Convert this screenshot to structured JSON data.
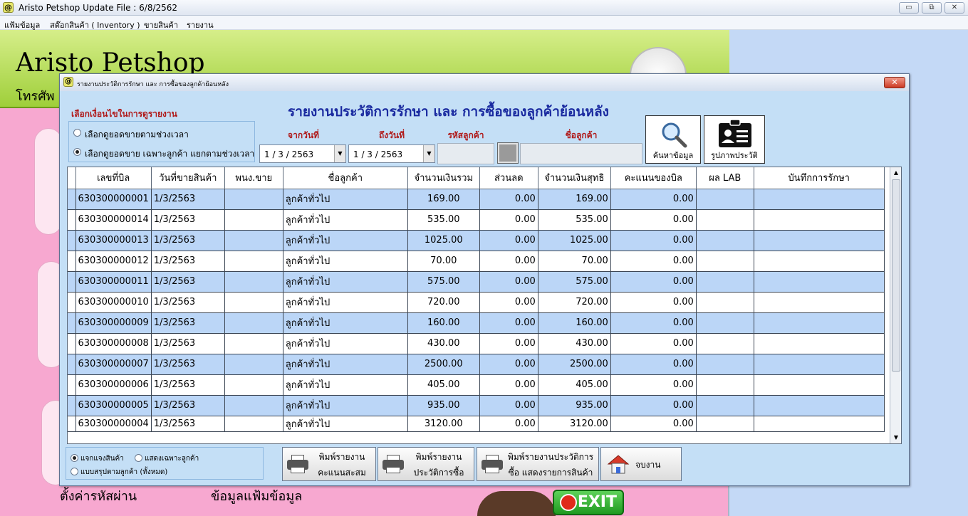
{
  "window": {
    "title": "Aristo Petshop  Update File : 6/8/2562",
    "logo_glyph": "@",
    "minimize_glyph": "▭",
    "restore_glyph": "⧉",
    "close_glyph": "✕"
  },
  "menu": [
    "แฟ้มข้อมูล",
    "สต๊อกสินค้า ( Inventory )",
    "ขายสินค้า",
    "รายงาน"
  ],
  "background": {
    "brand": "Aristo Petshop",
    "phone_prefix": "โทรศัพ",
    "left_text": "ตั้งค่ารหัสผ่าน",
    "middle_text": "ข้อมูลแฟ้มข้อมูล",
    "exit_label": "EXIT"
  },
  "dialog": {
    "title": "รายงานประวัติการรักษา และ การซื้อของลูกค้าย้อนหลัง",
    "heading": "รายงานประวัติการรักษา และ การซื้อของลูกค้าย้อนหลัง",
    "close_glyph": "✕",
    "conditions": {
      "label": "เลือกเงื่อนไขในการดูรายงาน",
      "options": [
        "เลือกดูยอดขายตามช่วงเวลา",
        "เลือกดูยอดขาย เฉพาะลูกค้า แยกตามช่วงเวลา"
      ],
      "selected_index": 1
    },
    "filters": {
      "from_label": "จากวันที่",
      "from_value": "1 / 3 / 2563",
      "to_label": "ถึงวันที่",
      "to_value": "1 / 3 / 2563",
      "customer_id_label": "รหัสลูกค้า",
      "customer_id_value": "",
      "customer_name_label": "ชื่อลูกค้า",
      "customer_name_value": "",
      "dropdown_arrow": "▼"
    },
    "search_button": "ค้นหาข้อมูล",
    "history_button": "รูปภาพประวัติ"
  },
  "grid": {
    "columns": [
      "เลขที่บิล",
      "วันที่ขายสินค้า",
      "พนง.ขาย",
      "ชื่อลูกค้า",
      "จำนวนเงินรวม",
      "ส่วนลด",
      "จำนวนเงินสุทธิ",
      "คะแนนของบิล",
      "ผล LAB",
      "บันทึกการรักษา"
    ],
    "rows": [
      {
        "bill": "630300000001",
        "date": "1/3/2563",
        "staff": "",
        "customer": "ลูกค้าทั่วไป",
        "total": "169.00",
        "discount": "0.00",
        "net": "169.00",
        "points": "0.00",
        "lab": "",
        "note": ""
      },
      {
        "bill": "630300000014",
        "date": "1/3/2563",
        "staff": "",
        "customer": "ลูกค้าทั่วไป",
        "total": "535.00",
        "discount": "0.00",
        "net": "535.00",
        "points": "0.00",
        "lab": "",
        "note": ""
      },
      {
        "bill": "630300000013",
        "date": "1/3/2563",
        "staff": "",
        "customer": "ลูกค้าทั่วไป",
        "total": "1025.00",
        "discount": "0.00",
        "net": "1025.00",
        "points": "0.00",
        "lab": "",
        "note": ""
      },
      {
        "bill": "630300000012",
        "date": "1/3/2563",
        "staff": "",
        "customer": "ลูกค้าทั่วไป",
        "total": "70.00",
        "discount": "0.00",
        "net": "70.00",
        "points": "0.00",
        "lab": "",
        "note": ""
      },
      {
        "bill": "630300000011",
        "date": "1/3/2563",
        "staff": "",
        "customer": "ลูกค้าทั่วไป",
        "total": "575.00",
        "discount": "0.00",
        "net": "575.00",
        "points": "0.00",
        "lab": "",
        "note": ""
      },
      {
        "bill": "630300000010",
        "date": "1/3/2563",
        "staff": "",
        "customer": "ลูกค้าทั่วไป",
        "total": "720.00",
        "discount": "0.00",
        "net": "720.00",
        "points": "0.00",
        "lab": "",
        "note": ""
      },
      {
        "bill": "630300000009",
        "date": "1/3/2563",
        "staff": "",
        "customer": "ลูกค้าทั่วไป",
        "total": "160.00",
        "discount": "0.00",
        "net": "160.00",
        "points": "0.00",
        "lab": "",
        "note": ""
      },
      {
        "bill": "630300000008",
        "date": "1/3/2563",
        "staff": "",
        "customer": "ลูกค้าทั่วไป",
        "total": "430.00",
        "discount": "0.00",
        "net": "430.00",
        "points": "0.00",
        "lab": "",
        "note": ""
      },
      {
        "bill": "630300000007",
        "date": "1/3/2563",
        "staff": "",
        "customer": "ลูกค้าทั่วไป",
        "total": "2500.00",
        "discount": "0.00",
        "net": "2500.00",
        "points": "0.00",
        "lab": "",
        "note": ""
      },
      {
        "bill": "630300000006",
        "date": "1/3/2563",
        "staff": "",
        "customer": "ลูกค้าทั่วไป",
        "total": "405.00",
        "discount": "0.00",
        "net": "405.00",
        "points": "0.00",
        "lab": "",
        "note": ""
      },
      {
        "bill": "630300000005",
        "date": "1/3/2563",
        "staff": "",
        "customer": "ลูกค้าทั่วไป",
        "total": "935.00",
        "discount": "0.00",
        "net": "935.00",
        "points": "0.00",
        "lab": "",
        "note": ""
      },
      {
        "bill": "630300000004",
        "date": "1/3/2563",
        "staff": "",
        "customer": "ลูกค้าทั่วไป",
        "total": "3120.00",
        "discount": "0.00",
        "net": "3120.00",
        "points": "0.00",
        "lab": "",
        "note": ""
      }
    ],
    "scroll_up_glyph": "▲",
    "scroll_down_glyph": "▼"
  },
  "bottom_options": {
    "options": [
      "แจกแจงสินค้า",
      "แสดงเฉพาะลูกค้า",
      "แบบสรุปตามลูกค้า (ทั้งหมด)"
    ],
    "selected_index": 0
  },
  "print_buttons": [
    {
      "line1": "พิมพ์รายงาน",
      "line2": "คะแนนสะสม"
    },
    {
      "line1": "พิมพ์รายงาน",
      "line2": "ประวัติการซื้อ"
    },
    {
      "line1": "พิมพ์รายงานประวัติการ",
      "line2": "ซื้อ แสดงรายการสินค้า"
    }
  ],
  "finish_button": "จบงาน",
  "colors": {
    "heading": "#1a2aa0",
    "condition_label": "#b01a1a",
    "row_alt": "#bbd6f7",
    "dialog_bg": "#c4dff6",
    "bg_form": "#f7a8d0",
    "bg_header": "#9fcf3a"
  }
}
